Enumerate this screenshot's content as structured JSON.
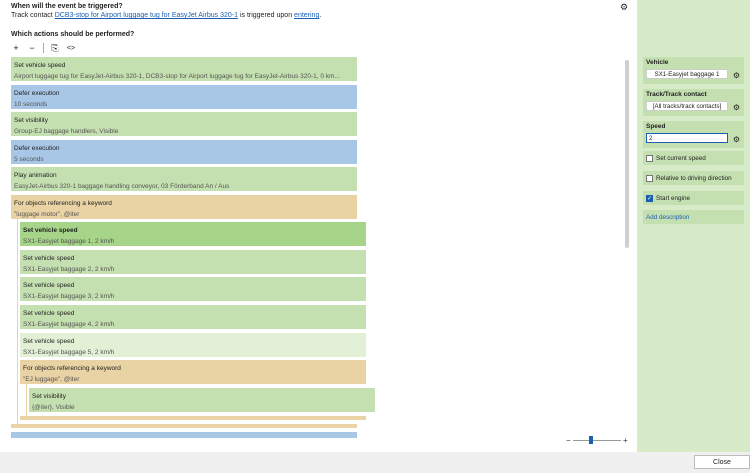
{
  "header": {
    "question_when": "When will the event be triggered?",
    "trigger_prefix": "Track contact",
    "trigger_link": "DCB3-stop for Airport luggage tug for EasyJet Airbus 320-1",
    "trigger_mid": "is triggered upon",
    "trigger_event": "entering",
    "trigger_end": ".",
    "question_actions": "Which actions should be performed?"
  },
  "toolbar": {
    "add": "+",
    "remove": "−",
    "copy": "⎘",
    "code": "<>"
  },
  "actions": [
    {
      "title": "Set vehicle speed",
      "sub": "Airport luggage tug for EasyJet-Airbus 320-1, DCB3-stop for Airport luggage tug for EasyJet-Airbus 320-1, 0 km..."
    },
    {
      "title": "Defer execution",
      "sub": "10 seconds"
    },
    {
      "title": "Set visibility",
      "sub": "Group-EJ baggage handlers, Visible"
    },
    {
      "title": "Defer execution",
      "sub": "5 seconds"
    },
    {
      "title": "Play animation",
      "sub": "EasyJet-Airbus 320-1 baggage handling conveyor, 03 Förderband An / Aus"
    },
    {
      "title": "For objects referencing a keyword",
      "sub": "\"luggage motor\", @iter"
    },
    {
      "title": "Set vehicle speed",
      "sub": "SX1-Easyjet baggage 1, 2 km/h"
    },
    {
      "title": "Set vehicle speed",
      "sub": "SX1-Easyjet baggage 2, 2 km/h"
    },
    {
      "title": "Set vehicle speed",
      "sub": "SX1-Easyjet baggage 3, 2 km/h"
    },
    {
      "title": "Set vehicle speed",
      "sub": "SX1-Easyjet baggage 4, 2 km/h"
    },
    {
      "title": "Set vehicle speed",
      "sub": "SX1-Easyjet baggage 5, 2 km/h"
    },
    {
      "title": "For objects referencing a keyword",
      "sub": "\"EJ luggage\", @iter"
    },
    {
      "title": "Set visibility",
      "sub": "{@iter}, Visible"
    }
  ],
  "zoom": {
    "minus": "−",
    "plus": "+"
  },
  "sidebar": {
    "vehicle_label": "Vehicle",
    "vehicle_value": "SX1-Easyjet baggage 1",
    "contact_label": "Track/Track contact",
    "contact_value": "[All tracks/track contacts]",
    "speed_label": "Speed",
    "speed_value": "2",
    "set_current_speed": "Set current speed",
    "relative_direction": "Relative to driving direction",
    "start_engine": "Start engine",
    "start_engine_checked": true,
    "add_description": "Add description"
  },
  "footer": {
    "close": "Close"
  },
  "colors": {
    "green": "#c5e0b0",
    "blue": "#a8c6e6",
    "tan": "#e9d3a4",
    "selected": "#a6d488",
    "accent": "#1a5fb4"
  }
}
